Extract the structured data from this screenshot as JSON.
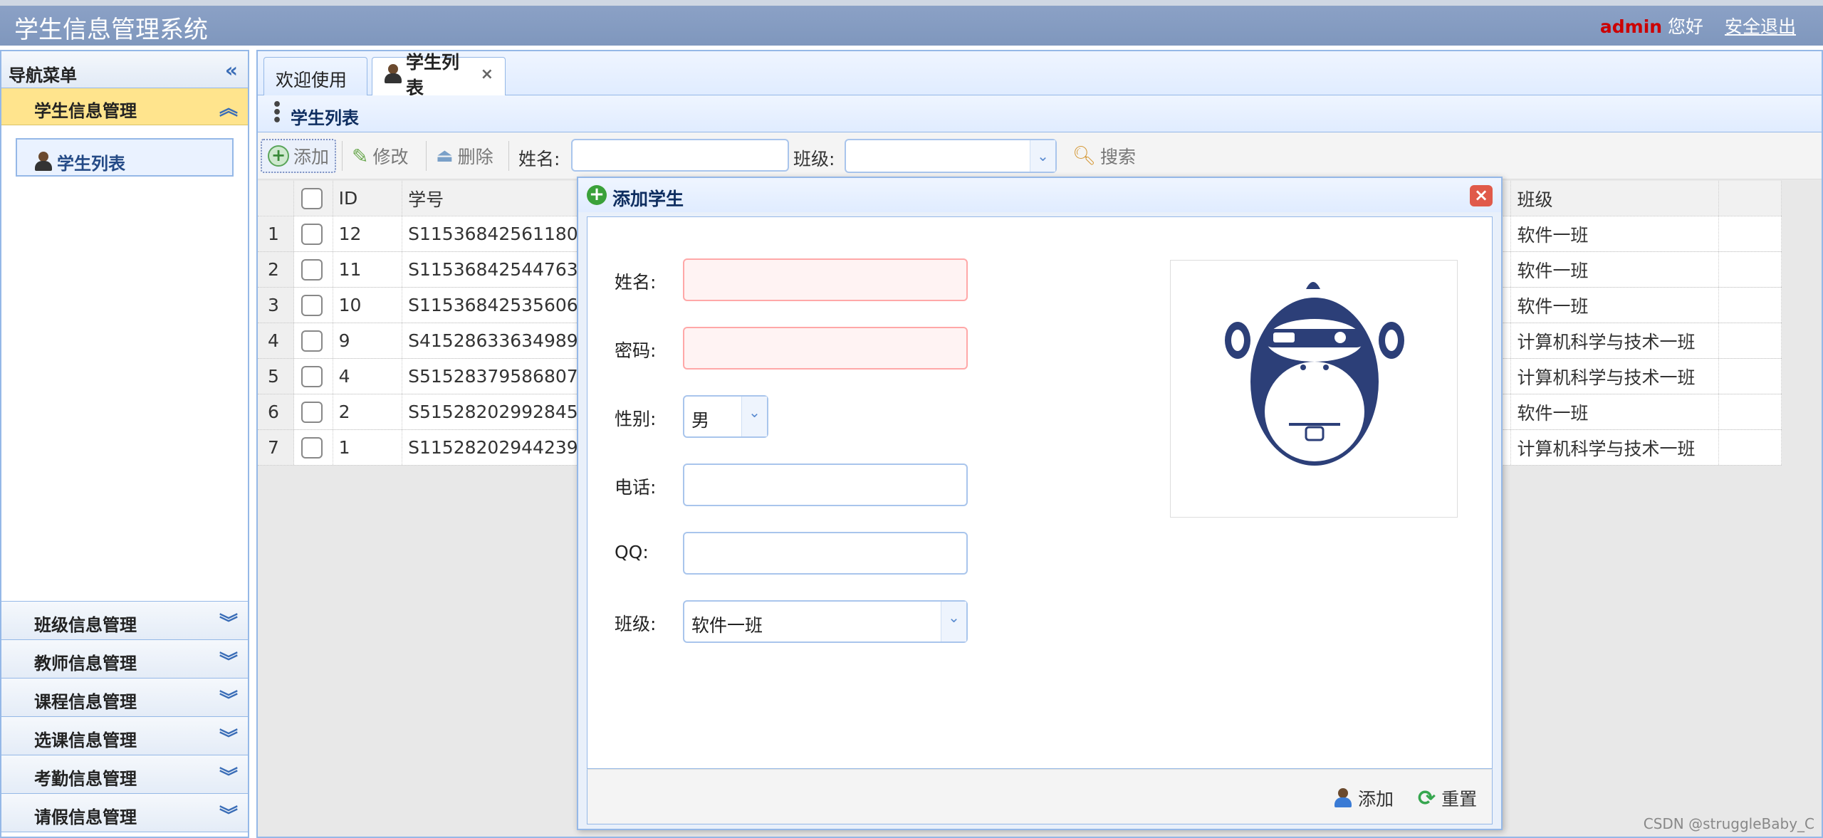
{
  "header": {
    "title": "学生信息管理系统",
    "user": "admin",
    "greeting": "您好",
    "logout": "安全退出"
  },
  "sidebar": {
    "title": "导航菜单",
    "active_group": "学生信息管理",
    "active_item": "学生列表",
    "groups": [
      "班级信息管理",
      "教师信息管理",
      "课程信息管理",
      "选课信息管理",
      "考勤信息管理",
      "请假信息管理"
    ]
  },
  "tabs": [
    {
      "label": "欢迎使用"
    },
    {
      "label": "学生列表",
      "close": "×"
    }
  ],
  "panel": {
    "title": "学生列表"
  },
  "toolbar": {
    "add": "添加",
    "edit": "修改",
    "delete": "删除",
    "name_label": "姓名:",
    "class_label": "班级:",
    "search": "搜索"
  },
  "grid": {
    "headers": {
      "id": "ID",
      "sno": "学号",
      "class": "班级"
    },
    "rows": [
      {
        "n": "1",
        "id": "12",
        "sno": "S11536842561180",
        "class": "软件一班"
      },
      {
        "n": "2",
        "id": "11",
        "sno": "S11536842544763",
        "class": "软件一班"
      },
      {
        "n": "3",
        "id": "10",
        "sno": "S11536842535606",
        "class": "软件一班"
      },
      {
        "n": "4",
        "id": "9",
        "sno": "S41528633634989",
        "class": "计算机科学与技术一班"
      },
      {
        "n": "5",
        "id": "4",
        "sno": "S51528379586807",
        "class": "计算机科学与技术一班"
      },
      {
        "n": "6",
        "id": "2",
        "sno": "S51528202992845",
        "class": "软件一班"
      },
      {
        "n": "7",
        "id": "1",
        "sno": "S11528202944239",
        "class": "计算机科学与技术一班"
      }
    ]
  },
  "dialog": {
    "title": "添加学生",
    "close": "×",
    "fields": {
      "name": {
        "label": "姓名:",
        "value": ""
      },
      "password": {
        "label": "密码:",
        "value": ""
      },
      "gender": {
        "label": "性别:",
        "value": "男"
      },
      "phone": {
        "label": "电话:",
        "value": ""
      },
      "qq": {
        "label": "QQ:",
        "value": ""
      },
      "class": {
        "label": "班级:",
        "value": "软件一班"
      }
    },
    "add_button": "添加",
    "reset_button": "重置"
  },
  "watermark": "CSDN @struggleBaby_C",
  "colors": {
    "header": "#7f97bd",
    "accent_border": "#95b8e7",
    "active_menu": "#ffe48d",
    "admin": "#cc0000"
  }
}
